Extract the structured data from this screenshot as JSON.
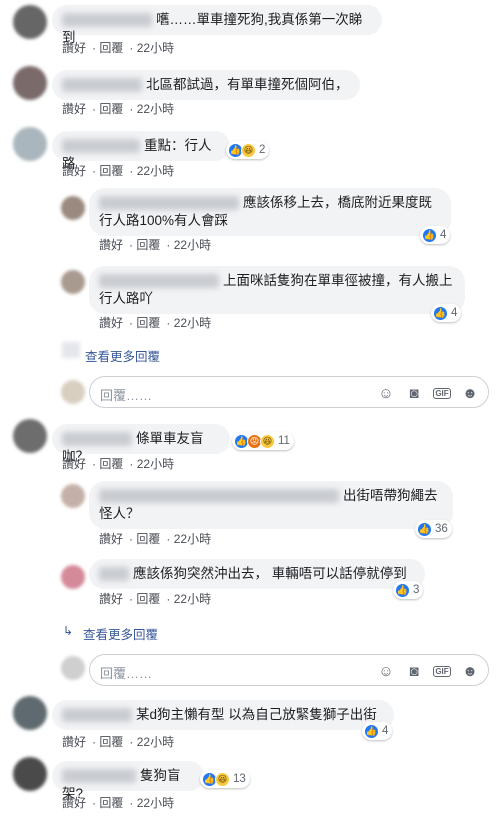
{
  "actions": {
    "like": "讚好",
    "reply": "回覆"
  },
  "comments": [
    {
      "text": "嚿……單車撞死狗,我真係第一次睇到",
      "time": "22小時"
    },
    {
      "text": "北區都試過，有單車撞死個阿伯，",
      "time": "22小時"
    },
    {
      "text": "重點：行人路",
      "time": "22小時",
      "reactions": {
        "count": "2",
        "icons": [
          "like-icon",
          "haha-icon"
        ]
      }
    },
    {
      "text": "應該係移上去，橋底附近果度既行人路100%有人會踩",
      "time": "22小時",
      "reactions": {
        "count": "4",
        "icons": [
          "like-icon"
        ]
      }
    },
    {
      "text": "上面咪話隻狗在單車徑被撞，有人搬上行人路吖",
      "time": "22小時",
      "reactions": {
        "count": "4",
        "icons": [
          "like-icon"
        ]
      }
    },
    {
      "text": "條單車友盲咖？",
      "time": "22小時",
      "reactions": {
        "count": "11",
        "icons": [
          "like-icon",
          "angry-icon",
          "haha-icon"
        ]
      }
    },
    {
      "text": "出街唔帶狗繩去怪人？",
      "time": "22小時",
      "reactions": {
        "count": "36",
        "icons": [
          "like-icon"
        ]
      }
    },
    {
      "text": "應該係狗突然沖出去， 車輛唔可以話停就停到",
      "time": "22小時",
      "reactions": {
        "count": "3",
        "icons": [
          "like-icon"
        ]
      }
    },
    {
      "text": "某d狗主懶有型 以為自己放緊隻獅子出街",
      "time": "22小時",
      "reactions": {
        "count": "4",
        "icons": [
          "like-icon"
        ]
      }
    },
    {
      "text": "隻狗盲架?",
      "time": "22小時",
      "reactions": {
        "count": "13",
        "icons": [
          "like-icon",
          "haha-icon"
        ]
      }
    }
  ],
  "view_more": "查看更多回覆",
  "reply_placeholder": "回覆……",
  "colors": {
    "link": "#385898",
    "bubble": "#f2f3f5",
    "like": "#2078f4"
  }
}
